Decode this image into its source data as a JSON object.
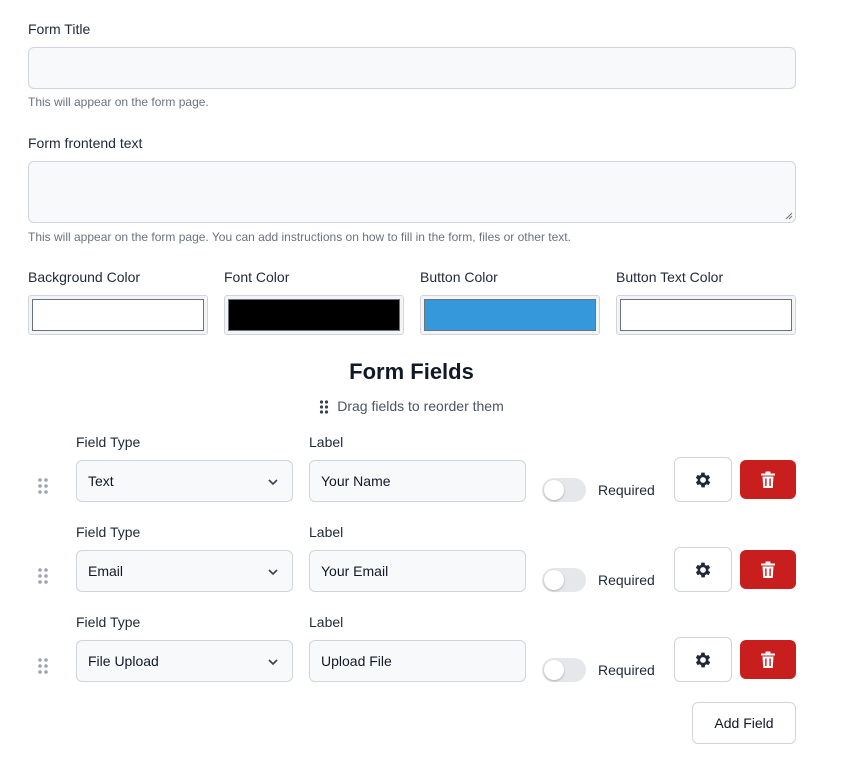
{
  "form_title": {
    "label": "Form Title",
    "value": "",
    "help": "This will appear on the form page."
  },
  "frontend_text": {
    "label": "Form frontend text",
    "value": "",
    "help": "This will appear on the form page. You can add instructions on how to fill in the form, files or other text."
  },
  "colors": [
    {
      "label": "Background Color",
      "value": "#ffffff"
    },
    {
      "label": "Font Color",
      "value": "#000000"
    },
    {
      "label": "Button Color",
      "value": "#3498db"
    },
    {
      "label": "Button Text Color",
      "value": "#ffffff"
    }
  ],
  "form_fields": {
    "title": "Form Fields",
    "hint": "Drag fields to reorder them",
    "field_type_label": "Field Type",
    "label_label": "Label",
    "required_label": "Required",
    "rows": [
      {
        "type": "Text",
        "label": "Your Name",
        "required": false
      },
      {
        "type": "Email",
        "label": "Your Email",
        "required": false
      },
      {
        "type": "File Upload",
        "label": "Upload File",
        "required": false
      }
    ],
    "add_button": "Add Field"
  },
  "icons": {
    "drag": "drag-handle-icon",
    "chevron": "chevron-down-icon",
    "settings": "gear-icon",
    "delete": "trash-icon"
  },
  "theme": {
    "danger": "#c81e1e",
    "border": "#d1d5db",
    "input_bg": "#f8f9fb"
  }
}
